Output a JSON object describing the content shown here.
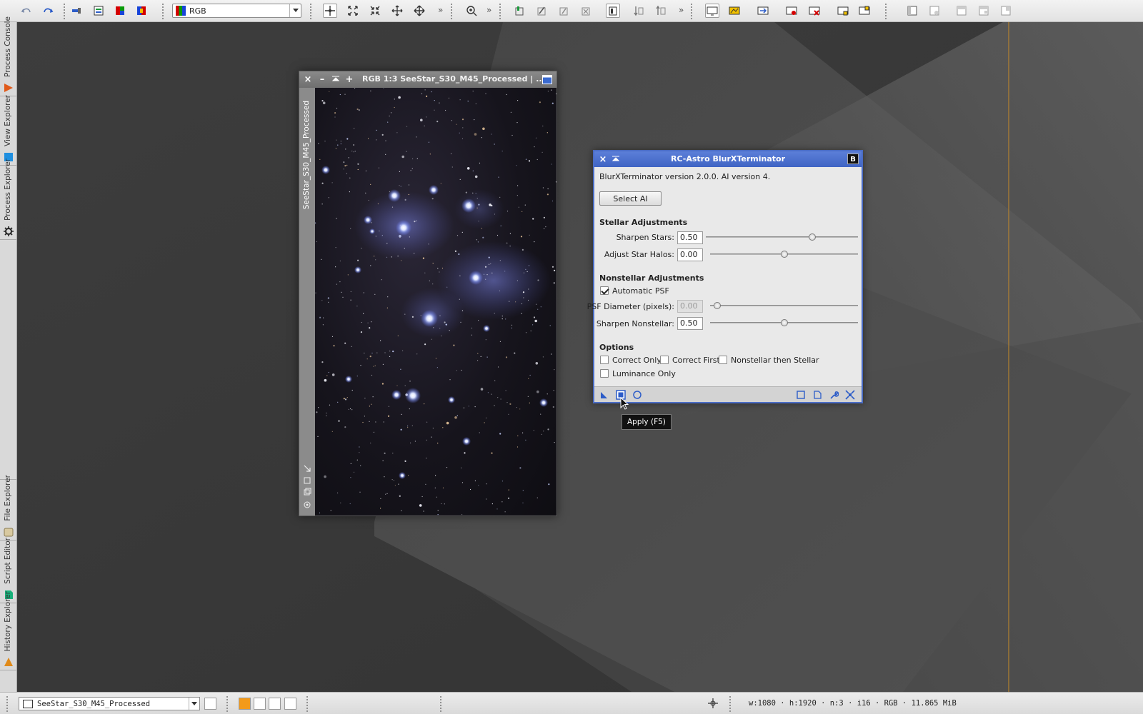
{
  "toolbar": {
    "colorspace": {
      "selected": "RGB"
    },
    "icons": [
      "undo-icon",
      "redo-icon",
      "new-instance-icon",
      "image-container-icon",
      "rgb-channels-icon",
      "color-channels-icon",
      "pan-mode-icon",
      "zoom-fit-icon",
      "zoom-contract-icon",
      "move-icon",
      "move-all-icon",
      "zoom-in-icon",
      "readout-icon",
      "preview-edit-icon",
      "preview-new-icon",
      "preview-delete-icon",
      "mask-enabled-icon",
      "mask-show-icon",
      "mask-invert-icon",
      "screen-icon",
      "stf-icon",
      "stf-auto-icon",
      "remove-icon",
      "remove-all-icon",
      "link-icon",
      "link-auto-icon",
      "layout-1-icon",
      "layout-2-icon",
      "layout-3-icon",
      "layout-4-icon",
      "layout-5-icon"
    ]
  },
  "dock": {
    "tabs": [
      {
        "label": "Process Console",
        "icon": "process-console-icon"
      },
      {
        "label": "View Explorer",
        "icon": "view-explorer-icon"
      },
      {
        "label": "Process Explorer",
        "icon": "gear-icon"
      },
      {
        "label": "File Explorer",
        "icon": "folder-icon"
      },
      {
        "label": "Script Editor",
        "icon": "script-icon"
      },
      {
        "label": "History Explorer",
        "icon": "history-icon"
      }
    ]
  },
  "image_window": {
    "title": "RGB 1:3 SeeStar_S30_M45_Processed | ...",
    "side_label": "SeeStar_S30_M45_Processed",
    "image_description_icon": "pleiades-starfield-image"
  },
  "dialog": {
    "title": "RC-Astro BlurXTerminator",
    "title_badge": "B",
    "version_text": "BlurXTerminator version 2.0.0. AI version 4.",
    "select_ai_label": "Select AI",
    "stellar": {
      "heading": "Stellar Adjustments",
      "sharpen_stars": {
        "label": "Sharpen Stars:",
        "value": "0.50",
        "fraction": 0.7
      },
      "adjust_halos": {
        "label": "Adjust Star Halos:",
        "value": "0.00",
        "fraction": 0.5
      }
    },
    "nonstellar": {
      "heading": "Nonstellar Adjustments",
      "auto_psf": {
        "label": "Automatic PSF",
        "checked": true
      },
      "psf_diameter": {
        "label": "PSF Diameter (pixels):",
        "value": "0.00",
        "fraction": 0.05,
        "disabled": true
      },
      "sharpen_nonstellar": {
        "label": "Sharpen Nonstellar:",
        "value": "0.50",
        "fraction": 0.5
      }
    },
    "options": {
      "heading": "Options",
      "correct_only": {
        "label": "Correct Only",
        "checked": false
      },
      "correct_first": {
        "label": "Correct First",
        "checked": false
      },
      "nonstellar_then_stellar": {
        "label": "Nonstellar then Stellar",
        "checked": false
      },
      "luminance_only": {
        "label": "Luminance Only",
        "checked": false
      }
    },
    "tooltip": "Apply (F5)"
  },
  "statusbar": {
    "view_selected": "SeeStar_S30_M45_Processed",
    "image_info": "w:1080 · h:1920 · n:3 · i16 · RGB · 11.865 MiB"
  }
}
